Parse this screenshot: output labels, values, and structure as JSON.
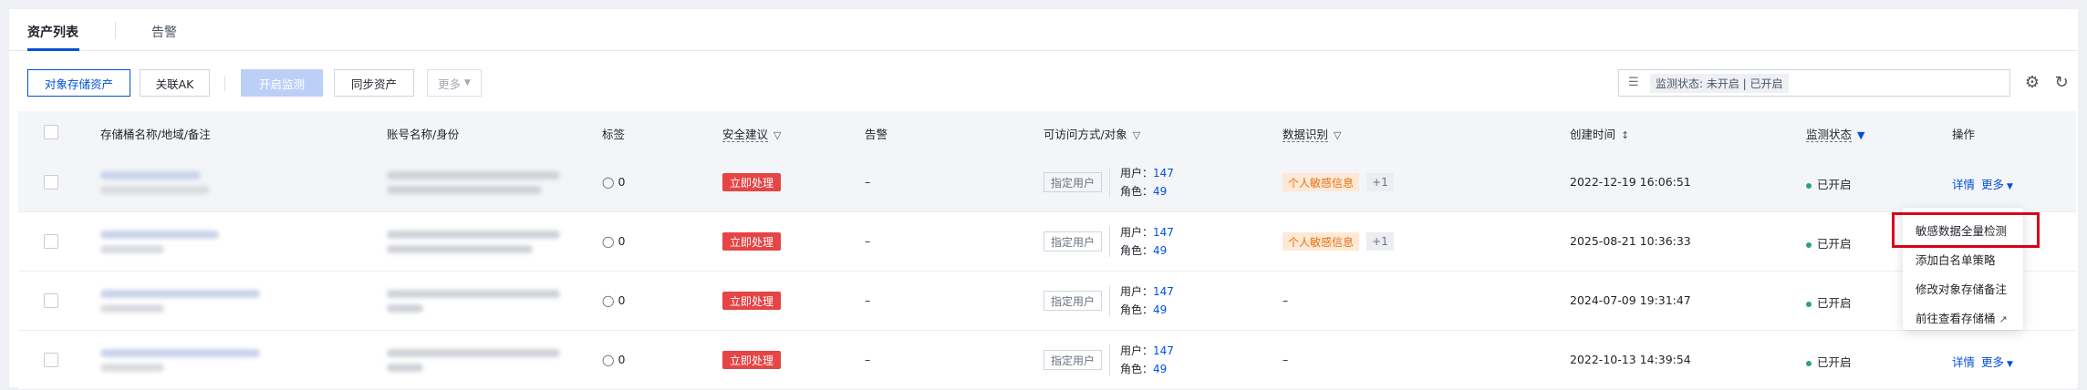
{
  "tabs": {
    "assets": "资产列表",
    "alerts": "告警"
  },
  "toolbar": {
    "storage_assets": "对象存储资产",
    "link_ak": "关联AK",
    "enable_monitor": "开启监测",
    "sync_assets": "同步资产",
    "more": "更多"
  },
  "search": {
    "tag": "监测状态: 未开启 | 已开启"
  },
  "table": {
    "headers": {
      "bucket": "存储桶名称/地域/备注",
      "account": "账号名称/身份",
      "tags": "标签",
      "security": "安全建议",
      "alerts": "告警",
      "access": "可访问方式/对象",
      "data_id": "数据识别",
      "created": "创建时间",
      "monitor_status": "监测状态",
      "actions": "操作"
    },
    "rows": [
      {
        "tag_count": "0",
        "security": "立即处理",
        "alert": "–",
        "access_type": "指定用户",
        "users_label": "用户：",
        "users": "147",
        "roles_label": "角色：",
        "roles": "49",
        "data_tag": "个人敏感信息",
        "data_more": "+1",
        "created": "2022-12-19 16:06:51",
        "status": "已开启",
        "detail": "详情",
        "more": "更多"
      },
      {
        "tag_count": "0",
        "security": "立即处理",
        "alert": "–",
        "access_type": "指定用户",
        "users_label": "用户：",
        "users": "147",
        "roles_label": "角色：",
        "roles": "49",
        "data_tag": "个人敏感信息",
        "data_more": "+1",
        "created": "2025-08-21 10:36:33",
        "status": "已开启"
      },
      {
        "tag_count": "0",
        "security": "立即处理",
        "alert": "–",
        "access_type": "指定用户",
        "users_label": "用户：",
        "users": "147",
        "roles_label": "角色：",
        "roles": "49",
        "data_empty": "–",
        "created": "2024-07-09 19:31:47",
        "status": "已开启"
      },
      {
        "tag_count": "0",
        "security": "立即处理",
        "alert": "–",
        "access_type": "指定用户",
        "users_label": "用户：",
        "users": "147",
        "roles_label": "角色：",
        "roles": "49",
        "data_empty": "–",
        "created": "2022-10-13 14:39:54",
        "status": "已开启",
        "detail": "详情",
        "more": "更多"
      }
    ]
  },
  "menu": {
    "items": [
      "敏感数据全量检测",
      "添加白名单策略",
      "修改对象存储备注",
      "前往查看存储桶"
    ]
  },
  "colors": {
    "primary": "#0052d9",
    "danger": "#e54545",
    "success": "#2ba471",
    "warning_bg": "#fde9d6",
    "warning_text": "#e37318",
    "highlight_box": "#d9001b"
  },
  "icons": [
    "tag-icon",
    "filter-icon",
    "sort-icon",
    "gear-icon",
    "refresh-icon",
    "search-icon",
    "chevron-down-icon",
    "external-link-icon"
  ]
}
